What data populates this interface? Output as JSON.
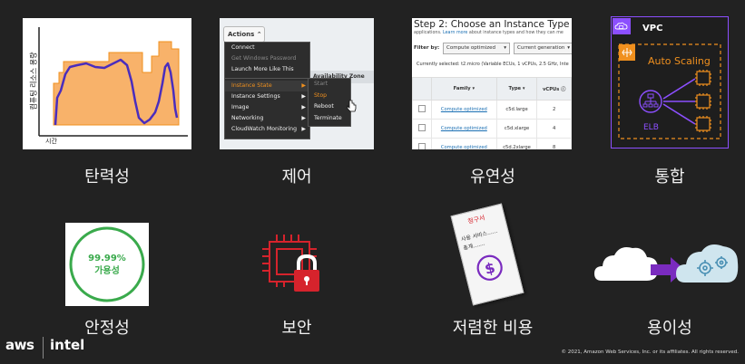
{
  "tile_elasticity": {
    "y_label": "컴퓨팅 리소스 용량",
    "x_label": "시간",
    "caption": "탄력성"
  },
  "tile_control": {
    "actions_label": "Actions",
    "column_label": "Availability Zone",
    "menu_items": [
      {
        "label": "Connect",
        "state": "normal",
        "submenu": false
      },
      {
        "label": "Get Windows Password",
        "state": "disabled",
        "submenu": false
      },
      {
        "label": "Launch More Like This",
        "state": "normal",
        "submenu": false
      },
      {
        "label": "Instance State",
        "state": "active",
        "submenu": true
      },
      {
        "label": "Instance Settings",
        "state": "normal",
        "submenu": true
      },
      {
        "label": "Image",
        "state": "normal",
        "submenu": true
      },
      {
        "label": "Networking",
        "state": "normal",
        "submenu": true
      },
      {
        "label": "CloudWatch Monitoring",
        "state": "normal",
        "submenu": true
      }
    ],
    "submenu_items": [
      {
        "label": "Start",
        "state": "disabled"
      },
      {
        "label": "Stop",
        "state": "selected"
      },
      {
        "label": "Reboot",
        "state": "normal"
      },
      {
        "label": "Terminate",
        "state": "normal"
      }
    ],
    "caption": "제어"
  },
  "tile_flexibility": {
    "heading": "Step 2: Choose an Instance Type",
    "subtext_prefix": "applications.",
    "subtext_link": "Learn more",
    "subtext_suffix": "about instance types and how they can me",
    "filter_label": "Filter by:",
    "filter_value": "Compute optimized",
    "generation_value": "Current generation",
    "currently_selected": "Currently selected: t2.micro (Variable ECUs, 1 vCPUs, 2.5 GHz, Inte",
    "columns": [
      "Family",
      "Type",
      "vCPUs"
    ],
    "rows": [
      {
        "family": "Compute optimized",
        "type": "c5d.large",
        "vcpus": "2"
      },
      {
        "family": "Compute optimized",
        "type": "c5d.xlarge",
        "vcpus": "4"
      },
      {
        "family": "Compute optimized",
        "type": "c5d.2xlarge",
        "vcpus": "8"
      }
    ],
    "caption": "유연성"
  },
  "tile_integration": {
    "vpc_label": "VPC",
    "autoscaling_label": "Auto Scaling",
    "elb_label": "ELB",
    "caption": "통합"
  },
  "tile_stability": {
    "percent": "99.99%",
    "label": "가용성",
    "caption": "안정성"
  },
  "tile_security": {
    "caption": "보안"
  },
  "tile_cost": {
    "doc_title": "청구서",
    "doc_line1": "사용 서비스......",
    "doc_line2": "총계.......",
    "caption": "저렴한 비용"
  },
  "tile_ease": {
    "caption": "용이성"
  },
  "footer": {
    "aws": "aws",
    "intel": "intel",
    "copyright": "© 2021, Amazon Web Services, Inc. or its affiliates. All rights reserved."
  },
  "colors": {
    "background": "#222222",
    "aws_orange": "#f0901e",
    "chart_orange": "#f8b26a",
    "chart_line": "#4a2dbd",
    "vpc_purple": "#8c4fff",
    "ring_green": "#3aaa4c",
    "cost_purple": "#7a2bbf",
    "security_red": "#d6232c"
  },
  "icons": [
    "cloud-icon",
    "chip-lock-icon",
    "invoice-dollar-icon",
    "vpc-cloud-icon",
    "elb-icon",
    "ec2-instance-icon",
    "autoscaling-icon"
  ]
}
